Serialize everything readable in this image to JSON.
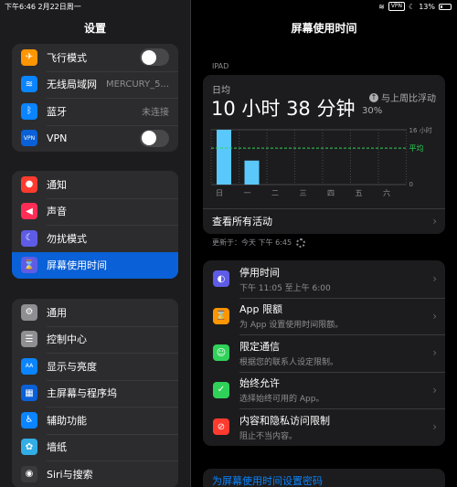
{
  "status_bar": {
    "time_date": "下午6:46   2月22日周一",
    "vpn": "VPN",
    "battery": "13%"
  },
  "sidebar": {
    "title": "设置",
    "group1": [
      {
        "label": "飞行模式",
        "icon": "airplane-icon",
        "icon_glyph": "✈",
        "color": "#ff9500",
        "toggle": "off"
      },
      {
        "label": "无线局域网",
        "icon": "wifi-icon",
        "icon_glyph": "≋",
        "color": "#0a84ff",
        "value": "MERCURY_5..."
      },
      {
        "label": "蓝牙",
        "icon": "bluetooth-icon",
        "icon_glyph": "ᛒ",
        "color": "#0a84ff",
        "value": "未连接"
      },
      {
        "label": "VPN",
        "icon": "vpn-icon",
        "icon_glyph": "VPN",
        "color": "#0a60d6",
        "toggle": "off"
      }
    ],
    "group2": [
      {
        "label": "通知",
        "icon": "notifications-icon",
        "icon_glyph": "●",
        "color": "#ff3b30"
      },
      {
        "label": "声音",
        "icon": "sound-icon",
        "icon_glyph": "◀",
        "color": "#ff2d55"
      },
      {
        "label": "勿扰模式",
        "icon": "moon-icon",
        "icon_glyph": "☾",
        "color": "#5e5ce6"
      },
      {
        "label": "屏幕使用时间",
        "icon": "hourglass-icon",
        "icon_glyph": "⌛",
        "color": "#5e5ce6",
        "selected": true
      }
    ],
    "group3": [
      {
        "label": "通用",
        "icon": "gear-icon",
        "icon_glyph": "⚙",
        "color": "#8e8e93"
      },
      {
        "label": "控制中心",
        "icon": "control-center-icon",
        "icon_glyph": "☰",
        "color": "#8e8e93"
      },
      {
        "label": "显示与亮度",
        "icon": "display-icon",
        "icon_glyph": "AA",
        "color": "#0a84ff"
      },
      {
        "label": "主屏幕与程序坞",
        "icon": "home-screen-icon",
        "icon_glyph": "▦",
        "color": "#0a60d6"
      },
      {
        "label": "辅助功能",
        "icon": "accessibility-icon",
        "icon_glyph": "♿",
        "color": "#0a84ff"
      },
      {
        "label": "墙纸",
        "icon": "wallpaper-icon",
        "icon_glyph": "✿",
        "color": "#32ade6"
      },
      {
        "label": "Siri与搜索",
        "icon": "siri-icon",
        "icon_glyph": "◉",
        "color": "#3a3a3c"
      }
    ]
  },
  "main": {
    "title": "屏幕使用时间",
    "section": "IPAD",
    "summary": {
      "avg_label": "日均",
      "avg_value": "10 小时 38 分钟",
      "compare_label": "与上周比浮动",
      "compare_pct": "30%",
      "link": "查看所有活动"
    },
    "updated": "更新于：今天 下午 6:45",
    "options": [
      {
        "title": "停用时间",
        "subtitle": "下午 11:05 至上午 6:00",
        "icon": "downtime-icon",
        "icon_glyph": "◐",
        "color": "#5e5ce6"
      },
      {
        "title": "App 限额",
        "subtitle": "为 App 设置使用时间限额。",
        "icon": "app-limits-icon",
        "icon_glyph": "⌛",
        "color": "#ff9500"
      },
      {
        "title": "限定通信",
        "subtitle": "根据您的联系人设定限制。",
        "icon": "communication-icon",
        "icon_glyph": "☺",
        "color": "#30d158"
      },
      {
        "title": "始终允许",
        "subtitle": "选择始终可用的 App。",
        "icon": "always-allowed-icon",
        "icon_glyph": "✓",
        "color": "#30d158"
      },
      {
        "title": "内容和隐私访问限制",
        "subtitle": "阻止不当内容。",
        "icon": "restrictions-icon",
        "icon_glyph": "⊘",
        "color": "#ff3b30"
      }
    ],
    "passcode_link": "为屏幕使用时间设置密码"
  },
  "chart_data": {
    "type": "bar",
    "categories": [
      "日",
      "一",
      "二",
      "三",
      "四",
      "五",
      "六"
    ],
    "values": [
      16,
      7,
      0,
      0,
      0,
      0,
      0
    ],
    "average": 10.63,
    "average_label": "平均",
    "y_max_label": "16 小时",
    "y_min_label": "0",
    "ylim": [
      0,
      16
    ],
    "colors": {
      "bar": "#5ac8fa",
      "average": "#30d158",
      "grid": "#48484a"
    }
  }
}
